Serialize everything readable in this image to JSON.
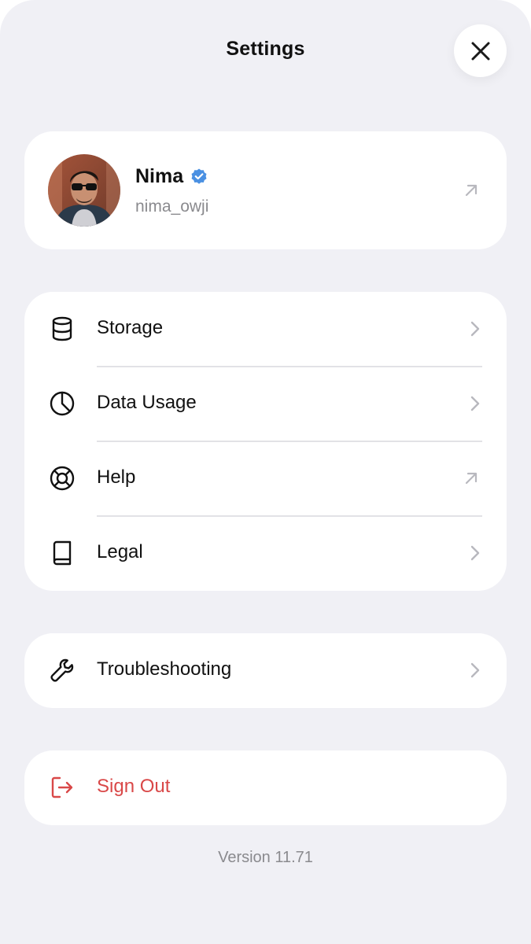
{
  "header": {
    "title": "Settings",
    "close_icon": "close-icon"
  },
  "profile": {
    "name": "Nima",
    "handle": "nima_owji",
    "verified": true,
    "verified_color": "#4a90e2",
    "arrow_icon": "external-arrow-icon"
  },
  "menu": {
    "items": [
      {
        "label": "Storage",
        "icon": "database-icon",
        "trailing": "chevron-right-icon"
      },
      {
        "label": "Data Usage",
        "icon": "pie-chart-icon",
        "trailing": "chevron-right-icon"
      },
      {
        "label": "Help",
        "icon": "lifebuoy-icon",
        "trailing": "external-arrow-icon"
      },
      {
        "label": "Legal",
        "icon": "book-icon",
        "trailing": "chevron-right-icon"
      }
    ]
  },
  "troubleshooting": {
    "label": "Troubleshooting",
    "icon": "wrench-icon",
    "trailing": "chevron-right-icon"
  },
  "sign_out": {
    "label": "Sign Out",
    "icon": "sign-out-icon",
    "color": "#d94848"
  },
  "footer": {
    "version": "Version 11.71"
  }
}
